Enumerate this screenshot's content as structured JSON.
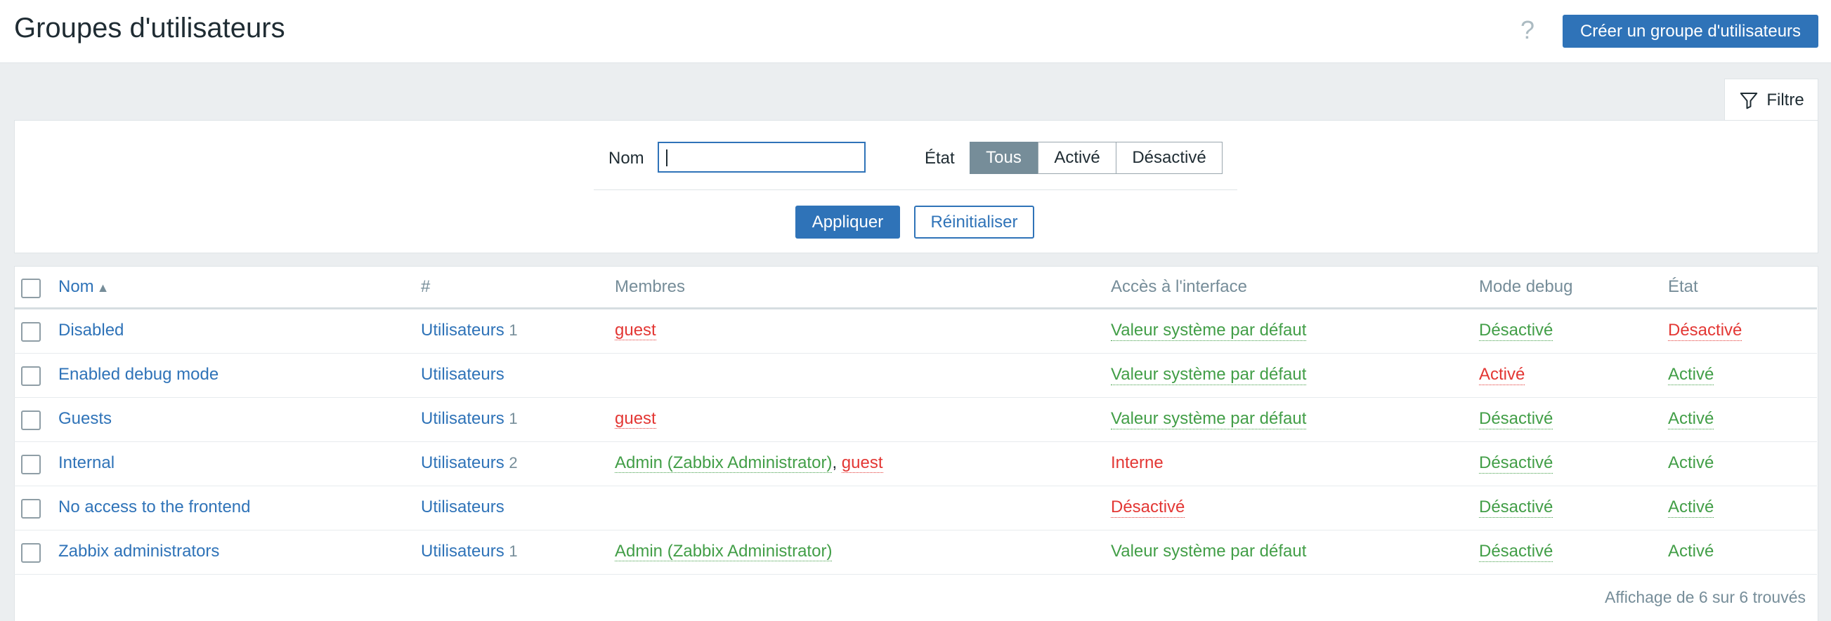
{
  "header": {
    "title": "Groupes d'utilisateurs",
    "help": "?",
    "create_button": "Créer un groupe d'utilisateurs"
  },
  "filter": {
    "tab_label": "Filtre",
    "name_label": "Nom",
    "name_value": "",
    "state_label": "État",
    "state_options": [
      "Tous",
      "Activé",
      "Désactivé"
    ],
    "state_selected": "Tous",
    "apply": "Appliquer",
    "reset": "Réinitialiser"
  },
  "table": {
    "columns": [
      "Nom",
      "#",
      "Membres",
      "Accès à l'interface",
      "Mode debug",
      "État"
    ],
    "sort_indicator": "▲",
    "rows": [
      {
        "name": "Disabled",
        "users_label": "Utilisateurs",
        "users_count": "1",
        "members": [
          "guest"
        ],
        "access": "Valeur système par défaut",
        "debug": "Désactivé",
        "state": "Désactivé"
      },
      {
        "name": "Enabled debug mode",
        "users_label": "Utilisateurs",
        "users_count": "",
        "members": [],
        "access": "Valeur système par défaut",
        "debug": "Activé",
        "state": "Activé"
      },
      {
        "name": "Guests",
        "users_label": "Utilisateurs",
        "users_count": "1",
        "members": [
          "guest"
        ],
        "access": "Valeur système par défaut",
        "debug": "Désactivé",
        "state": "Activé"
      },
      {
        "name": "Internal",
        "users_label": "Utilisateurs",
        "users_count": "2",
        "members": [
          "Admin (Zabbix Administrator)",
          "guest"
        ],
        "access": "Interne",
        "debug": "Désactivé",
        "state": "Activé"
      },
      {
        "name": "No access to the frontend",
        "users_label": "Utilisateurs",
        "users_count": "",
        "members": [],
        "access": "Désactivé",
        "debug": "Désactivé",
        "state": "Activé"
      },
      {
        "name": "Zabbix administrators",
        "users_label": "Utilisateurs",
        "users_count": "1",
        "members": [
          "Admin (Zabbix Administrator)"
        ],
        "access": "Valeur système par défaut",
        "debug": "Désactivé",
        "state": "Activé"
      }
    ]
  },
  "footer": {
    "summary": "Affichage de 6 sur 6 trouvés"
  },
  "colors": {
    "accent": "#2f73b8",
    "enabled": "#429e47",
    "disabled": "#e33734",
    "muted": "#768d99"
  }
}
